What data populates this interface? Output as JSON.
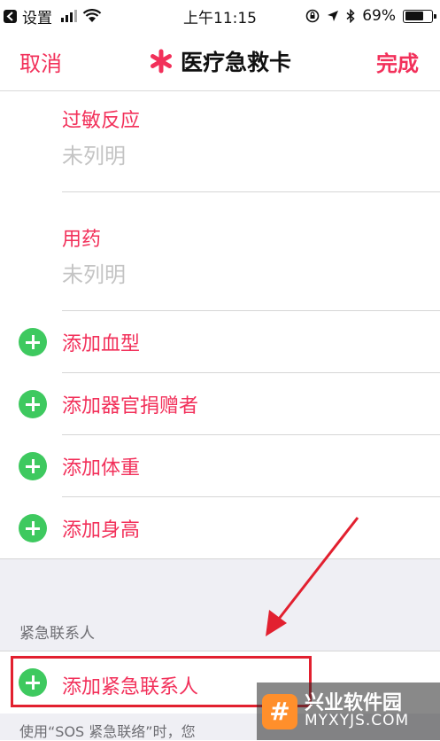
{
  "status_bar": {
    "back_app": "设置",
    "time": "上午11:15",
    "battery": "69%",
    "battery_level": 0.69
  },
  "nav": {
    "cancel": "取消",
    "title": "医疗急救卡",
    "done": "完成",
    "accent_color": "#f2305a"
  },
  "fields": [
    {
      "label": "过敏反应",
      "value": "未列明"
    },
    {
      "label": "用药",
      "value": "未列明"
    }
  ],
  "add_rows": [
    {
      "label": "添加血型"
    },
    {
      "label": "添加器官捐赠者"
    },
    {
      "label": "添加体重"
    },
    {
      "label": "添加身高"
    }
  ],
  "emergency": {
    "section_header": "紧急联系人",
    "add_contact": "添加紧急联系人",
    "footer_note": "使用“SOS 紧急联络”时，您"
  },
  "watermark": {
    "name": "兴业软件园",
    "url": "MYXYJS.COM",
    "logo_glyph": "#"
  },
  "icons": {
    "plus": "plus-circle-icon",
    "star": "medical-star-icon"
  }
}
